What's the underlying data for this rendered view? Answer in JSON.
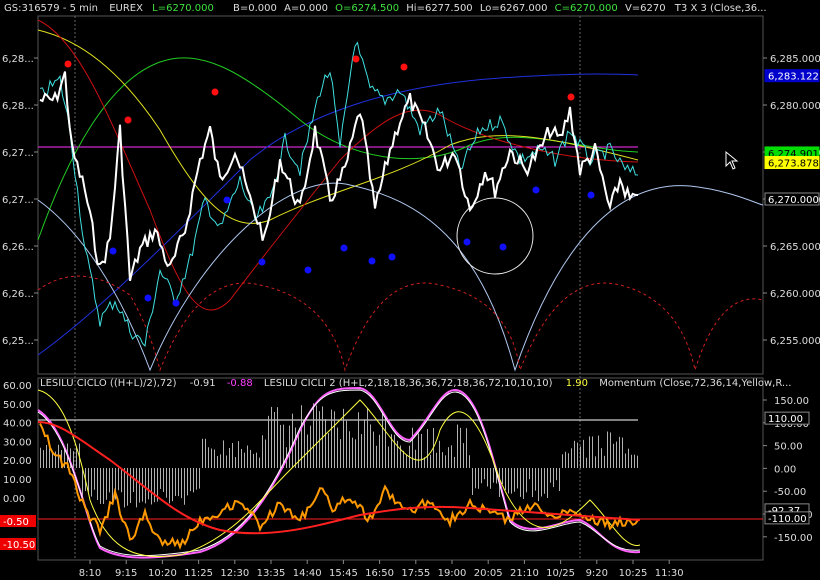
{
  "header": {
    "symbol": "GS:316579 - 5 min",
    "exchange": "EUREX",
    "last": "L=6270.000",
    "bid": "B=0.000",
    "ask": "A=0.000",
    "open": "O=6274.500",
    "high": "Hi=6277.500",
    "low": "Lo=6267.000",
    "close": "C=6270.000",
    "volume": "V=6270",
    "study": "T3 X 3  (Close,36..."
  },
  "ind_header": {
    "i1_name": "LESILU CICLO  ((H+L)/2),72)",
    "i1_val": "-0.91",
    "i2_val": "-0.88",
    "i2_name": "LESILU CICLI 2  (H+L,2,18,18,36,36,72,18,36,72,10,10,10)",
    "i3_val": "1.90",
    "i3_name": "Momentum  (Close,72,36,14,Yellow,R..."
  },
  "price_axis": {
    "ticks": [
      "6,285.000",
      "6,280.000",
      "6,275.000",
      "6,270.000",
      "6,265.000",
      "6,260.000",
      "6,255.000"
    ],
    "left_ticks": [
      "6,28...",
      "6,28...",
      "6,27...",
      "6,27...",
      "6,26...",
      "6,26...",
      "6,25..."
    ],
    "tags": [
      {
        "text": "6,283.122",
        "bg": "#0000cc",
        "fg": "#ffffff",
        "value": 6283.12
      },
      {
        "text": "6,274.901",
        "bg": "#00dd00",
        "fg": "#000000",
        "value": 6274.9
      },
      {
        "text": "6,273.878",
        "bg": "#ffff00",
        "fg": "#000000",
        "value": 6273.88
      },
      {
        "text": "6,270.000",
        "bg": "#000000",
        "fg": "#ffffff",
        "value": 6270
      }
    ]
  },
  "ind_axis": {
    "right_ticks": [
      "150.00",
      "100.00",
      "50.00",
      "0.00",
      "-50.00",
      "-100.00",
      "-150.00"
    ],
    "left_ticks": [
      "60.00",
      "50.00",
      "40.00",
      "30.00",
      "20.00",
      "10.00",
      "0.00"
    ],
    "right_tags": [
      {
        "text": "110.00",
        "bg": "#000000",
        "fg": "#ffffff",
        "value": 110
      },
      {
        "text": "-92.37",
        "bg": "#000000",
        "fg": "#ffffff",
        "value": -92.37
      },
      {
        "text": "-110.00",
        "bg": "#000000",
        "fg": "#ffffff",
        "value": -110
      }
    ],
    "left_tags": [
      {
        "text": "-0.50",
        "bg": "#ee0000",
        "fg": "#ffffff"
      },
      {
        "text": "-10.50",
        "bg": "#ee0000",
        "fg": "#ffffff"
      }
    ]
  },
  "time_axis": [
    "8:10",
    "9:15",
    "10:20",
    "11:25",
    "12:30",
    "13:35",
    "14:40",
    "15:45",
    "16:50",
    "17:55",
    "19:00",
    "20:05",
    "21:10",
    "10/25",
    "9:20",
    "10:25",
    "11:30"
  ],
  "colors": {
    "bg": "#000000",
    "price": "#ffffff",
    "cyan": "#40e0e0",
    "t3_red": "#cc1010",
    "t3_green": "#22cc22",
    "t3_yellow": "#e0e020",
    "t3_blue": "#2030dd",
    "cycle": "#b0c8f0",
    "level_line": "#ff30ff",
    "dots_red": "#ff1010",
    "dots_blue": "#1010ff",
    "osc_orange": "#ff9900",
    "osc_red": "#ff2020",
    "osc_magenta": "#ff60ff",
    "osc_yellow": "#ffff40",
    "osc_gray": "#b0b0b0"
  },
  "icons": {
    "cursor": "mouse-pointer-icon"
  }
}
